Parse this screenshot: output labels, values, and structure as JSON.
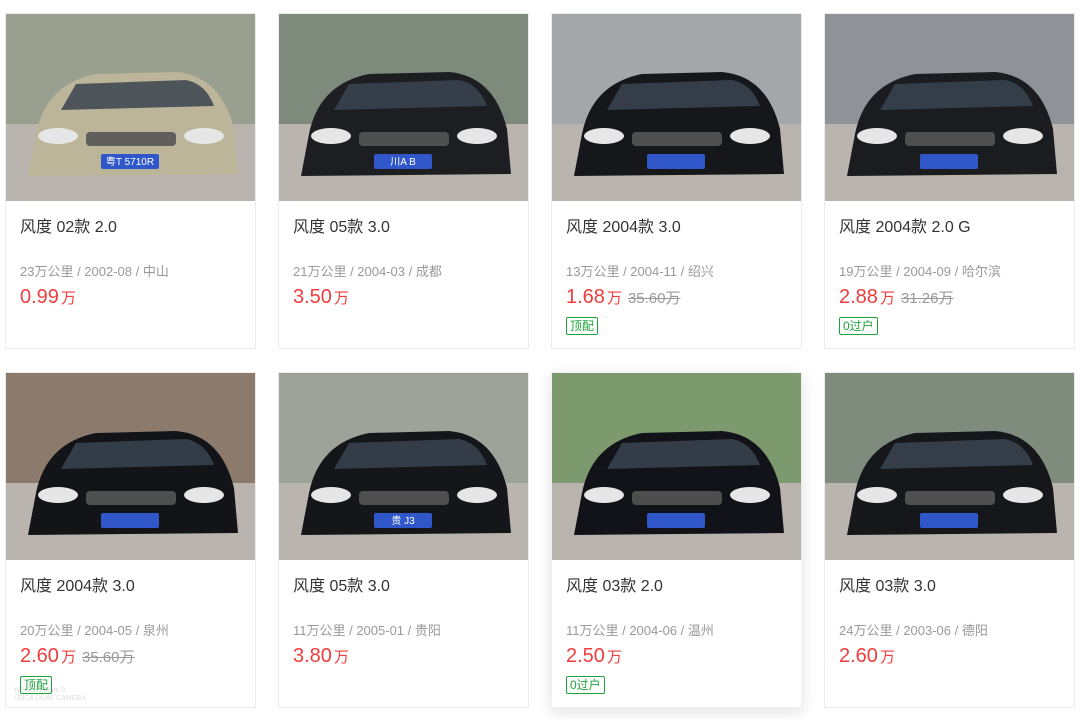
{
  "listings": [
    {
      "title": "风度 02款 2.0",
      "meta": "23万公里 / 2002-08 / 中山",
      "price": "0.99",
      "unit": "万",
      "original_price": "",
      "tag": "",
      "car_color": "#bdb59a",
      "bg": "#9aa08f",
      "plate": "粤T 5710R"
    },
    {
      "title": "风度 05款 3.0",
      "meta": "21万公里 / 2004-03 / 成都",
      "price": "3.50",
      "unit": "万",
      "original_price": "",
      "tag": "",
      "car_color": "#1c1e22",
      "bg": "#7e8a7b",
      "plate": "川A B"
    },
    {
      "title": "风度 2004款 3.0",
      "meta": "13万公里 / 2004-11 / 绍兴",
      "price": "1.68",
      "unit": "万",
      "original_price": "35.60万",
      "tag": "顶配",
      "car_color": "#15171b",
      "bg": "#a3a7aa",
      "plate": ""
    },
    {
      "title": "风度 2004款 2.0 G",
      "meta": "19万公里 / 2004-09 / 哈尔滨",
      "price": "2.88",
      "unit": "万",
      "original_price": "31.26万",
      "tag": "0过户",
      "car_color": "#1a1c20",
      "bg": "#8f9296",
      "plate": ""
    },
    {
      "title": "风度 2004款 3.0",
      "meta": "20万公里 / 2004-05 / 泉州",
      "price": "2.60",
      "unit": "万",
      "original_price": "35.60万",
      "tag": "顶配",
      "car_color": "#121418",
      "bg": "#8c7b6c",
      "plate": "",
      "watermark": [
        "HUAWEI Mate 9",
        "LEICA DUAL CAMERA"
      ]
    },
    {
      "title": "风度 05款 3.0",
      "meta": "11万公里 / 2005-01 / 贵阳",
      "price": "3.80",
      "unit": "万",
      "original_price": "",
      "tag": "",
      "car_color": "#14161a",
      "bg": "#9ea39a",
      "plate": "贵 J3"
    },
    {
      "title": "风度 03款 2.0",
      "meta": "11万公里 / 2004-06 / 温州",
      "price": "2.50",
      "unit": "万",
      "original_price": "",
      "tag": "0过户",
      "car_color": "#111318",
      "bg": "#7d9a6e",
      "plate": ""
    },
    {
      "title": "风度 03款 3.0",
      "meta": "24万公里 / 2003-06 / 德阳",
      "price": "2.60",
      "unit": "万",
      "original_price": "",
      "tag": "",
      "car_color": "#15171b",
      "bg": "#7f8b7d",
      "plate": ""
    }
  ]
}
